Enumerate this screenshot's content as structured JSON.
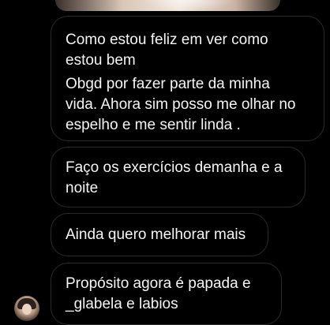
{
  "thread": {
    "messages": [
      {
        "paragraphs": [
          [
            "Como estou feliz em ver como",
            "estou bem"
          ],
          [
            "Obgd por fazer parte da minha",
            "vida. Ahora sim posso me olhar no",
            "espelho e me sentir linda ."
          ]
        ]
      },
      {
        "lines": [
          "Faço os exercícios demanha e a",
          "noite"
        ]
      },
      {
        "lines": [
          "Ainda quero melhorar mais"
        ]
      },
      {
        "lines": [
          "Propósito agora é papada  e",
          "_glabela  e labios"
        ]
      }
    ]
  },
  "sender": {
    "avatar_icon": "profile-photo"
  },
  "colors": {
    "background": "#000000",
    "bubble_border": "#2a2a2a",
    "text": "#f5f5f5"
  }
}
